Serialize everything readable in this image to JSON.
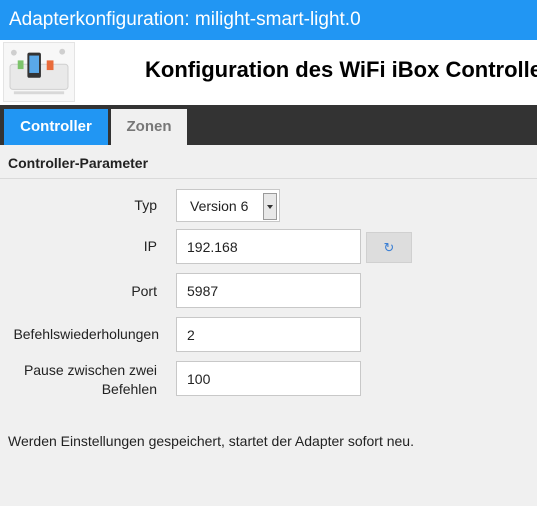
{
  "window": {
    "title": "Adapterkonfiguration: milight-smart-light.0"
  },
  "header": {
    "heading": "Konfiguration des WiFi iBox Controllers",
    "logo_icon": "milight-ibox-logo"
  },
  "tabs": [
    {
      "label": "Controller",
      "active": true
    },
    {
      "label": "Zonen",
      "active": false
    }
  ],
  "section": {
    "title": "Controller-Parameter"
  },
  "form": {
    "type": {
      "label": "Typ",
      "value": "Version 6"
    },
    "ip": {
      "label": "IP",
      "value": "192.168",
      "refresh_icon": "refresh-icon"
    },
    "port": {
      "label": "Port",
      "value": "5987"
    },
    "repeats": {
      "label": "Befehlswiederholungen",
      "value": "2"
    },
    "pause": {
      "label_line1": "Pause zwischen zwei",
      "label_line2": "Befehlen",
      "value": "100"
    }
  },
  "note": "Werden Einstellungen gespeichert, startet der Adapter sofort neu.",
  "colors": {
    "accent": "#2196f3",
    "tabbar": "#333333",
    "background": "#f0f0f0"
  }
}
